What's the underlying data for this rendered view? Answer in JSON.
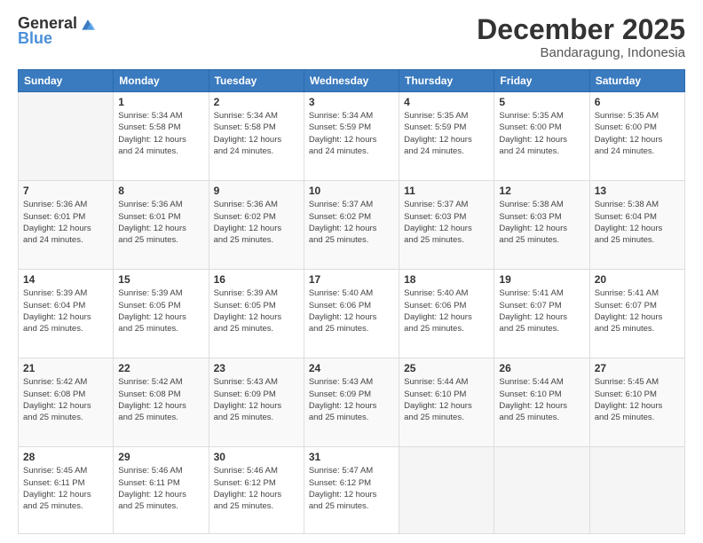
{
  "logo": {
    "general": "General",
    "blue": "Blue"
  },
  "title": {
    "month": "December 2025",
    "location": "Bandaragung, Indonesia"
  },
  "header_days": [
    "Sunday",
    "Monday",
    "Tuesday",
    "Wednesday",
    "Thursday",
    "Friday",
    "Saturday"
  ],
  "weeks": [
    [
      {
        "day": "",
        "info": ""
      },
      {
        "day": "1",
        "info": "Sunrise: 5:34 AM\nSunset: 5:58 PM\nDaylight: 12 hours\nand 24 minutes."
      },
      {
        "day": "2",
        "info": "Sunrise: 5:34 AM\nSunset: 5:58 PM\nDaylight: 12 hours\nand 24 minutes."
      },
      {
        "day": "3",
        "info": "Sunrise: 5:34 AM\nSunset: 5:59 PM\nDaylight: 12 hours\nand 24 minutes."
      },
      {
        "day": "4",
        "info": "Sunrise: 5:35 AM\nSunset: 5:59 PM\nDaylight: 12 hours\nand 24 minutes."
      },
      {
        "day": "5",
        "info": "Sunrise: 5:35 AM\nSunset: 6:00 PM\nDaylight: 12 hours\nand 24 minutes."
      },
      {
        "day": "6",
        "info": "Sunrise: 5:35 AM\nSunset: 6:00 PM\nDaylight: 12 hours\nand 24 minutes."
      }
    ],
    [
      {
        "day": "7",
        "info": "Sunrise: 5:36 AM\nSunset: 6:01 PM\nDaylight: 12 hours\nand 24 minutes."
      },
      {
        "day": "8",
        "info": "Sunrise: 5:36 AM\nSunset: 6:01 PM\nDaylight: 12 hours\nand 25 minutes."
      },
      {
        "day": "9",
        "info": "Sunrise: 5:36 AM\nSunset: 6:02 PM\nDaylight: 12 hours\nand 25 minutes."
      },
      {
        "day": "10",
        "info": "Sunrise: 5:37 AM\nSunset: 6:02 PM\nDaylight: 12 hours\nand 25 minutes."
      },
      {
        "day": "11",
        "info": "Sunrise: 5:37 AM\nSunset: 6:03 PM\nDaylight: 12 hours\nand 25 minutes."
      },
      {
        "day": "12",
        "info": "Sunrise: 5:38 AM\nSunset: 6:03 PM\nDaylight: 12 hours\nand 25 minutes."
      },
      {
        "day": "13",
        "info": "Sunrise: 5:38 AM\nSunset: 6:04 PM\nDaylight: 12 hours\nand 25 minutes."
      }
    ],
    [
      {
        "day": "14",
        "info": "Sunrise: 5:39 AM\nSunset: 6:04 PM\nDaylight: 12 hours\nand 25 minutes."
      },
      {
        "day": "15",
        "info": "Sunrise: 5:39 AM\nSunset: 6:05 PM\nDaylight: 12 hours\nand 25 minutes."
      },
      {
        "day": "16",
        "info": "Sunrise: 5:39 AM\nSunset: 6:05 PM\nDaylight: 12 hours\nand 25 minutes."
      },
      {
        "day": "17",
        "info": "Sunrise: 5:40 AM\nSunset: 6:06 PM\nDaylight: 12 hours\nand 25 minutes."
      },
      {
        "day": "18",
        "info": "Sunrise: 5:40 AM\nSunset: 6:06 PM\nDaylight: 12 hours\nand 25 minutes."
      },
      {
        "day": "19",
        "info": "Sunrise: 5:41 AM\nSunset: 6:07 PM\nDaylight: 12 hours\nand 25 minutes."
      },
      {
        "day": "20",
        "info": "Sunrise: 5:41 AM\nSunset: 6:07 PM\nDaylight: 12 hours\nand 25 minutes."
      }
    ],
    [
      {
        "day": "21",
        "info": "Sunrise: 5:42 AM\nSunset: 6:08 PM\nDaylight: 12 hours\nand 25 minutes."
      },
      {
        "day": "22",
        "info": "Sunrise: 5:42 AM\nSunset: 6:08 PM\nDaylight: 12 hours\nand 25 minutes."
      },
      {
        "day": "23",
        "info": "Sunrise: 5:43 AM\nSunset: 6:09 PM\nDaylight: 12 hours\nand 25 minutes."
      },
      {
        "day": "24",
        "info": "Sunrise: 5:43 AM\nSunset: 6:09 PM\nDaylight: 12 hours\nand 25 minutes."
      },
      {
        "day": "25",
        "info": "Sunrise: 5:44 AM\nSunset: 6:10 PM\nDaylight: 12 hours\nand 25 minutes."
      },
      {
        "day": "26",
        "info": "Sunrise: 5:44 AM\nSunset: 6:10 PM\nDaylight: 12 hours\nand 25 minutes."
      },
      {
        "day": "27",
        "info": "Sunrise: 5:45 AM\nSunset: 6:10 PM\nDaylight: 12 hours\nand 25 minutes."
      }
    ],
    [
      {
        "day": "28",
        "info": "Sunrise: 5:45 AM\nSunset: 6:11 PM\nDaylight: 12 hours\nand 25 minutes."
      },
      {
        "day": "29",
        "info": "Sunrise: 5:46 AM\nSunset: 6:11 PM\nDaylight: 12 hours\nand 25 minutes."
      },
      {
        "day": "30",
        "info": "Sunrise: 5:46 AM\nSunset: 6:12 PM\nDaylight: 12 hours\nand 25 minutes."
      },
      {
        "day": "31",
        "info": "Sunrise: 5:47 AM\nSunset: 6:12 PM\nDaylight: 12 hours\nand 25 minutes."
      },
      {
        "day": "",
        "info": ""
      },
      {
        "day": "",
        "info": ""
      },
      {
        "day": "",
        "info": ""
      }
    ]
  ]
}
